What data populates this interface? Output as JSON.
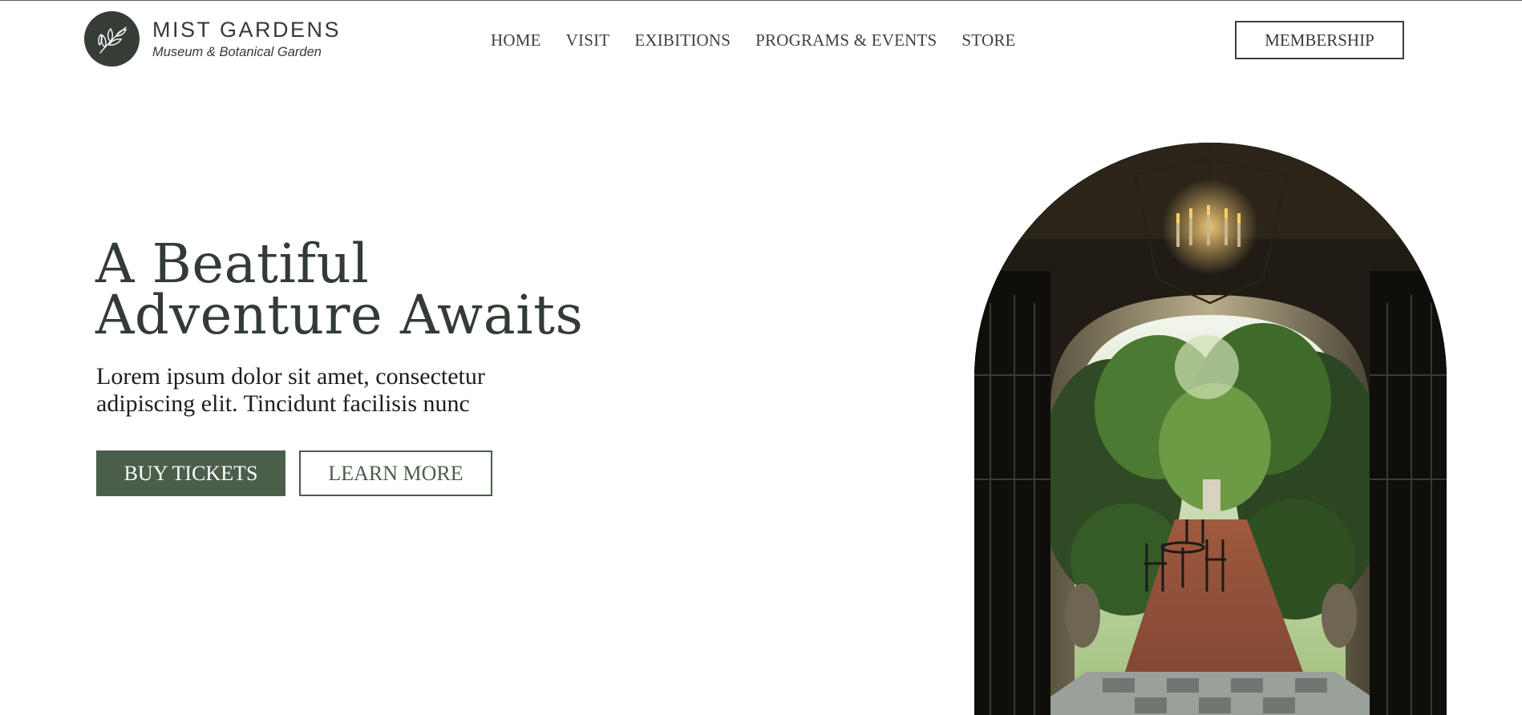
{
  "brand": {
    "name": "MIST GARDENS",
    "tagline": "Museum & Botanical Garden",
    "logo_icon": "olive-branch-icon"
  },
  "nav": {
    "items": [
      {
        "label": "HOME"
      },
      {
        "label": "VISIT"
      },
      {
        "label": "EXIBITIONS"
      },
      {
        "label": "PROGRAMS & EVENTS"
      },
      {
        "label": "STORE"
      }
    ],
    "membership_label": "MEMBERSHIP"
  },
  "hero": {
    "title_line1": "A Beatiful",
    "title_line2": "Adventure Awaits",
    "subtitle_line1": "Lorem ipsum dolor sit amet, consectetur",
    "subtitle_line2": "adipiscing elit. Tincidunt facilisis nunc",
    "primary_button": "BUY TICKETS",
    "secondary_button": "LEARN MORE",
    "image_subject": "arched-courtyard-garden-photo"
  },
  "colors": {
    "text_dark": "#333b35",
    "accent_green": "#4a5e49",
    "logo_bg": "#363d37",
    "background": "#ffffff"
  }
}
